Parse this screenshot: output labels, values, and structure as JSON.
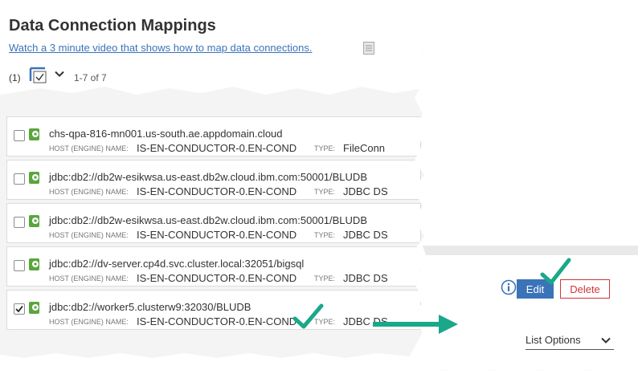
{
  "header": {
    "title": "Data Connection Mappings",
    "video_link": "Watch a 3 minute video that shows how to map data connections.",
    "selected_count": "(1)",
    "range": "1-7 of 7"
  },
  "labels": {
    "host": "HOST (ENGINE) NAME:",
    "type": "TYPE:"
  },
  "rows": [
    {
      "name": "chs-qpa-816-mn001.us-south.ae.appdomain.cloud",
      "host": "IS-EN-CONDUCTOR-0.EN-COND",
      "type": "FileConn",
      "checked": false
    },
    {
      "name": "jdbc:db2://db2w-esikwsa.us-east.db2w.cloud.ibm.com:50001/BLUDB",
      "host": "IS-EN-CONDUCTOR-0.EN-COND",
      "type": "JDBC DS",
      "checked": false
    },
    {
      "name": "jdbc:db2://db2w-esikwsa.us-east.db2w.cloud.ibm.com:50001/BLUDB",
      "host": "IS-EN-CONDUCTOR-0.EN-COND",
      "type": "JDBC DS",
      "checked": false
    },
    {
      "name": "jdbc:db2://dv-server.cp4d.svc.cluster.local:32051/bigsql",
      "host": "IS-EN-CONDUCTOR-0.EN-COND",
      "type": "JDBC DS",
      "checked": false
    },
    {
      "name": "jdbc:db2://worker5.clusterw9:32030/BLUDB",
      "host": "IS-EN-CONDUCTOR-0.EN-COND",
      "type": "JDBC DS",
      "checked": true
    }
  ],
  "actions": {
    "edit": "Edit",
    "delete": "Delete",
    "list_options": "List Options"
  },
  "colors": {
    "accent": "#3b73b9",
    "delete": "#d0353a",
    "annotation": "#1aa88a",
    "db_icon": "#5aa63c"
  },
  "icons": {
    "doc": "document-icon",
    "select_all": "select-checkbox-icon",
    "chevron": "chevron-down-icon",
    "info": "info-icon",
    "db": "database-connection-icon"
  }
}
